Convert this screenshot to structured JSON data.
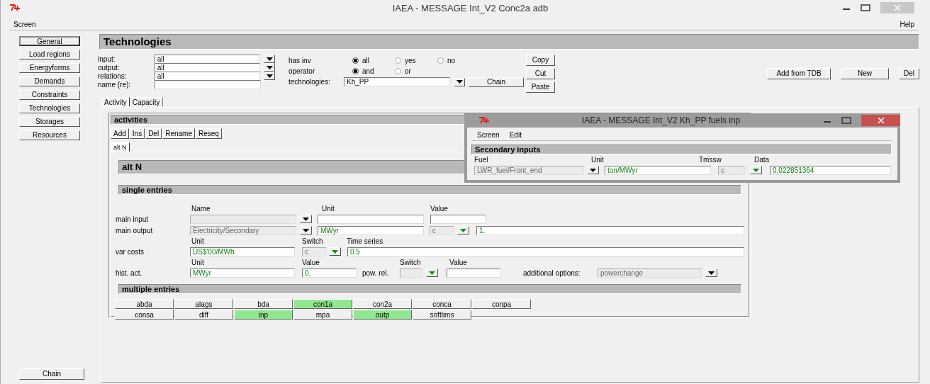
{
  "window": {
    "title": "IAEA - MESSAGE Int_V2 Conc2a adb"
  },
  "menu": [
    {
      "label": "Screen"
    },
    {
      "label": "Help"
    }
  ],
  "sidebar": {
    "items": [
      {
        "label": "General",
        "selected": true
      },
      {
        "label": "Load regions",
        "selected": false
      },
      {
        "label": "Energyforms",
        "selected": false
      },
      {
        "label": "Demands",
        "selected": false
      },
      {
        "label": "Constraints",
        "selected": false
      },
      {
        "label": "Technologies",
        "selected": false
      },
      {
        "label": "Storages",
        "selected": false
      },
      {
        "label": "Resources",
        "selected": false
      }
    ],
    "bottom_button": "Chain"
  },
  "page_title": "Technologies",
  "filters": [
    {
      "label": "input:",
      "kind": "dropdown",
      "value": "all"
    },
    {
      "label": "output:",
      "kind": "dropdown",
      "value": "all"
    },
    {
      "label": "relations:",
      "kind": "dropdown",
      "value": "all"
    },
    {
      "label": "name (re):",
      "kind": "text"
    }
  ],
  "options": [
    {
      "label": "has inv",
      "choices": [
        {
          "label": "all",
          "selected": true
        },
        {
          "label": "yes",
          "selected": false
        },
        {
          "label": "no",
          "selected": false
        }
      ]
    },
    {
      "label": "operator",
      "choices": [
        {
          "label": "and",
          "selected": true
        },
        {
          "label": "or",
          "selected": false
        }
      ]
    }
  ],
  "technologies": {
    "label": "technologies:",
    "value": "Kh_PP",
    "button": "Chain"
  },
  "edit_buttons": [
    "Copy",
    "Cut",
    "Paste"
  ],
  "actions": [
    "Add from TDB",
    "New",
    "Del"
  ],
  "tabs": [
    {
      "label": "Activity",
      "selected": true
    },
    {
      "label": "Capacity",
      "selected": false
    }
  ],
  "activities": {
    "title": "activities",
    "toolbar": [
      "Add",
      "Ins",
      "Del",
      "Rename",
      "Reseq"
    ],
    "tabs": [
      {
        "label": "alt N",
        "selected": true
      }
    ],
    "heading": "alt N",
    "single_title": "single entries",
    "single_rows": [
      [
        {
          "kind": "caption",
          "text": "Name"
        },
        {
          "kind": "caption",
          "text": "Unit"
        },
        {
          "kind": "caption",
          "text": "Value"
        }
      ],
      [
        {
          "kind": "label",
          "text": "main input"
        },
        {
          "kind": "field",
          "disabled": true
        },
        {
          "kind": "dropdown",
          "highlighted": false
        },
        {
          "kind": "field",
          "disabled": false
        },
        {
          "kind": "field",
          "disabled": false
        }
      ],
      [
        {
          "kind": "label",
          "text": "main output"
        },
        {
          "kind": "field",
          "value": "Electricity/Secondary",
          "disabled": true
        },
        {
          "kind": "dropdown",
          "highlighted": false
        },
        {
          "kind": "field",
          "value": "MWyr",
          "disabled": false
        },
        {
          "kind": "field",
          "value": "c",
          "disabled": true
        },
        {
          "kind": "dropdown",
          "highlighted": true
        },
        {
          "kind": "field",
          "value": "1.",
          "disabled": false
        }
      ],
      [
        {
          "kind": "caption",
          "text": "Unit"
        },
        {
          "kind": "caption",
          "text": "Switch"
        },
        {
          "kind": "caption",
          "text": "Time series"
        }
      ],
      [
        {
          "kind": "label",
          "text": "var costs"
        },
        {
          "kind": "field",
          "value": "US$'00/MWh",
          "disabled": false
        },
        {
          "kind": "field",
          "value": "c",
          "disabled": true
        },
        {
          "kind": "dropdown",
          "highlighted": true
        },
        {
          "kind": "field",
          "value": "0.5",
          "disabled": false
        }
      ],
      [
        {
          "kind": "caption",
          "text": "Unit"
        },
        {
          "kind": "caption",
          "text": "Value"
        },
        {
          "kind": "caption",
          "text": "Switch"
        },
        {
          "kind": "caption",
          "text": "Value"
        }
      ],
      [
        {
          "kind": "label",
          "text": "hist. act."
        },
        {
          "kind": "field",
          "value": "MWyr",
          "disabled": false
        },
        {
          "kind": "field",
          "value": "0.",
          "disabled": false
        },
        {
          "kind": "label",
          "text": "pow. rel."
        },
        {
          "kind": "field",
          "disabled": true
        },
        {
          "kind": "dropdown",
          "highlighted": true
        },
        {
          "kind": "field",
          "disabled": false
        },
        {
          "kind": "label",
          "text": "additional options:"
        },
        {
          "kind": "field",
          "value": "powerchange",
          "disabled": true
        },
        {
          "kind": "dropdown",
          "highlighted": false
        }
      ]
    ],
    "multiple_title": "multiple entries",
    "multiple": [
      {
        "label": "abda",
        "highlighted": false
      },
      {
        "label": "alags",
        "highlighted": false
      },
      {
        "label": "bda",
        "highlighted": false
      },
      {
        "label": "con1a",
        "highlighted": true
      },
      {
        "label": "con2a",
        "highlighted": false
      },
      {
        "label": "conca",
        "highlighted": false
      },
      {
        "label": "conpa",
        "highlighted": false
      },
      {
        "label": "consa",
        "highlighted": false
      },
      {
        "label": "diff",
        "highlighted": false
      },
      {
        "label": "inp",
        "highlighted": true
      },
      {
        "label": "mpa",
        "highlighted": false
      },
      {
        "label": "outp",
        "highlighted": true
      },
      {
        "label": "softlims",
        "highlighted": false
      }
    ]
  },
  "dialog": {
    "title": "IAEA - MESSAGE Int_V2 Kh_PP fuels inp",
    "menu": [
      {
        "label": "Screen"
      },
      {
        "label": "Edit"
      }
    ],
    "heading": "Secondary inputs",
    "rows": [
      [
        {
          "kind": "caption",
          "text": "Fuel"
        },
        {
          "kind": "caption",
          "text": "Unit"
        },
        {
          "kind": "caption",
          "text": "Tmssw"
        },
        {
          "kind": "caption",
          "text": "Data"
        }
      ],
      [
        {
          "kind": "field",
          "value": "LWR_fuel/Front_end",
          "disabled": true
        },
        {
          "kind": "dropdown",
          "highlighted": false
        },
        {
          "kind": "field",
          "value": "ton/MWyr",
          "disabled": false
        },
        {
          "kind": "field",
          "value": "c",
          "disabled": true
        },
        {
          "kind": "dropdown",
          "highlighted": true
        },
        {
          "kind": "field",
          "value": "0.022851364",
          "disabled": false
        }
      ]
    ]
  }
}
